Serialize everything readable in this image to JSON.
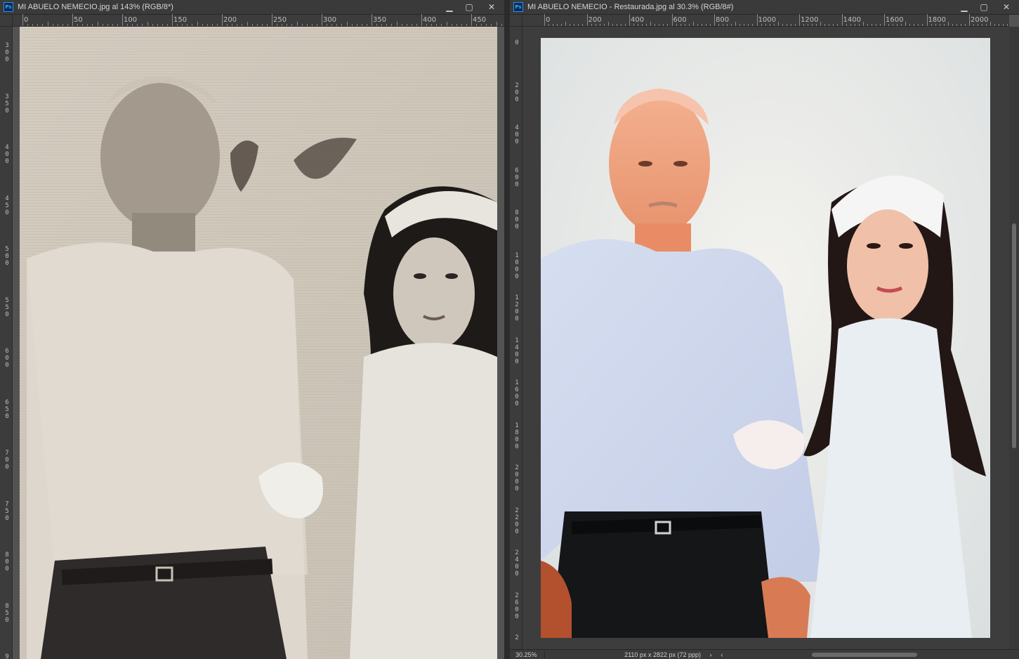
{
  "left_window": {
    "title": "MI ABUELO NEMECIO.jpg al 143% (RGB/8*)",
    "ps_badge": "Ps",
    "minimize": "▁",
    "maximize": "▢",
    "close": "✕",
    "ruler_h": [
      "0",
      "50",
      "100",
      "150",
      "200",
      "250",
      "300",
      "350",
      "400",
      "450"
    ],
    "ruler_v": [
      "300",
      "350",
      "400",
      "450",
      "500",
      "550",
      "600",
      "650",
      "700",
      "750",
      "800",
      "850",
      "9"
    ],
    "image_desc_icon": "photo-canvas"
  },
  "right_window": {
    "title": "MI ABUELO NEMECIO - Restaurada.jpg al 30.3% (RGB/8#)",
    "ps_badge": "Ps",
    "minimize": "▁",
    "maximize": "▢",
    "close": "✕",
    "ruler_h": [
      "0",
      "200",
      "400",
      "600",
      "800",
      "1000",
      "1200",
      "1400",
      "1600",
      "1800",
      "2000"
    ],
    "ruler_v": [
      "0",
      "200",
      "400",
      "600",
      "800",
      "1000",
      "1200",
      "1400",
      "1600",
      "1800",
      "2000",
      "2200",
      "2400",
      "2600",
      "2"
    ],
    "status": {
      "zoom": "30.25%",
      "doc_info": "2110 px x 2822 px (72 ppp)",
      "arrow_right": "›",
      "arrow_left": "‹"
    }
  },
  "colors": {
    "chrome_dark": "#3a3a3a",
    "ruler": "#3c3c3c",
    "workspace": "#535353",
    "ps_blue": "#31a8ff"
  }
}
